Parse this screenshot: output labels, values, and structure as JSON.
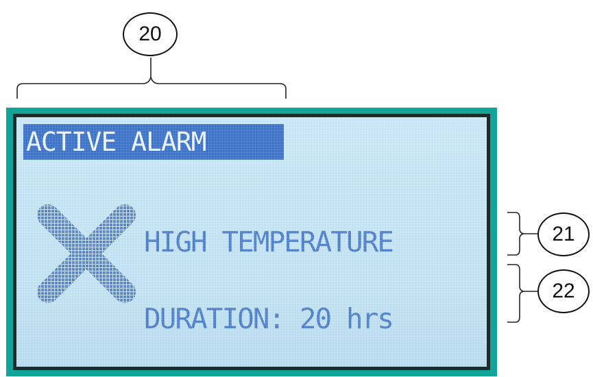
{
  "callouts": [
    {
      "id": "20"
    },
    {
      "id": "21"
    },
    {
      "id": "22"
    }
  ],
  "display": {
    "header": "ACTIVE ALARM",
    "alarm_icon": "x-mark-icon",
    "alarm_name": "HIGH TEMPERATURE",
    "duration_line": "DURATION: 20 hrs"
  },
  "colors": {
    "bezel": "#11a59a",
    "screen": "#c5e5f6",
    "header_bg": "#3a73cc",
    "text": "#4b7fcf"
  }
}
